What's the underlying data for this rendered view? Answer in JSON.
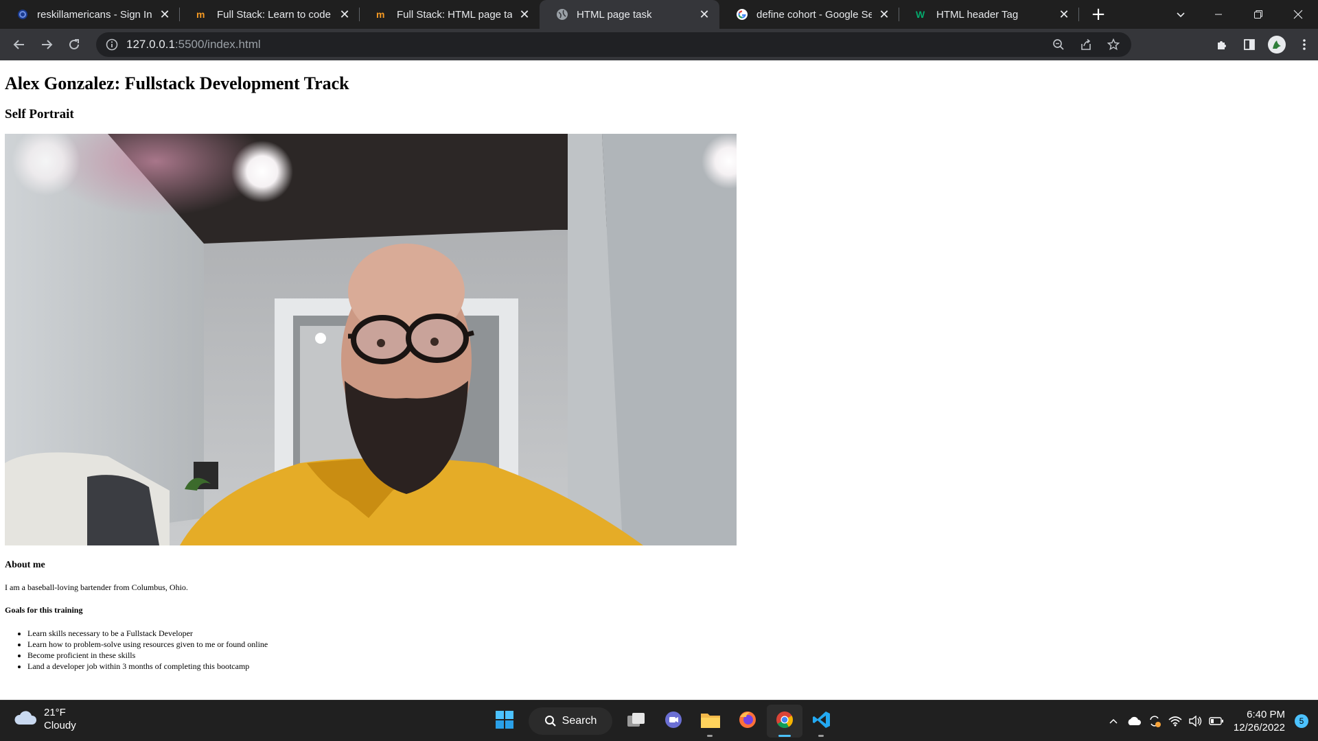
{
  "browser": {
    "tabs": [
      {
        "title": "reskillamericans - Sign In",
        "favicon": "circle-logo-icon"
      },
      {
        "title": "Full Stack: Learn to code HTML",
        "favicon": "m-logo-icon"
      },
      {
        "title": "Full Stack: HTML page task",
        "favicon": "m-logo-icon"
      },
      {
        "title": "HTML page task",
        "favicon": "globe-icon",
        "active": true
      },
      {
        "title": "define cohort - Google Search",
        "favicon": "google-icon"
      },
      {
        "title": "HTML header Tag",
        "favicon": "w-logo-icon"
      }
    ],
    "close_glyph": "✕",
    "new_tab_glyph": "+",
    "url_host": "127.0.0.1",
    "url_path": ":5500/index.html"
  },
  "page": {
    "title": "Alex Gonzalez: Fullstack Development Track",
    "portrait_heading": "Self Portrait",
    "about_heading": "About me",
    "about_text": "I am a baseball-loving bartender from Columbus, Ohio.",
    "goals_heading": "Goals for this training",
    "goals": [
      "Learn skills necessary to be a Fullstack Developer",
      "Learn how to problem-solve using resources given to me or found online",
      "Become proficient in these skills",
      "Land a developer job within 3 months of completing this bootcamp"
    ]
  },
  "taskbar": {
    "temperature": "21°F",
    "condition": "Cloudy",
    "search_label": "Search",
    "time": "6:40 PM",
    "date": "12/26/2022",
    "notification_count": "5"
  },
  "colors": {
    "chrome_dark": "#1f1f1f",
    "toolbar": "#35363a",
    "taskbar": "#202020",
    "accent": "#4cc2ff"
  }
}
